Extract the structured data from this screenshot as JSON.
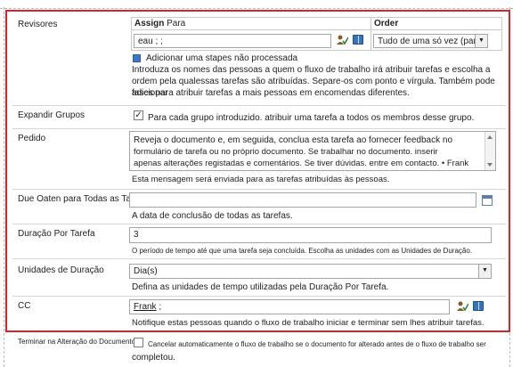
{
  "revisores": {
    "label": "Revisores",
    "assign_header": "Assign",
    "assign_header_sub": "Para",
    "order_header": "Order",
    "assign_value": "eau ; ;",
    "order_value": "Tudo de uma só vez (paralelo)",
    "add_stage": "Adicionar uma stapes não processada",
    "help_1": "Introduza os nomes das pessoas a quem o fluxo de trabalho irá atribuir tarefas e escolha a",
    "help_2": "ordem pela qualessas tarefas são atribuídas. Separe-os com ponto e vírgula. Também pode adicionar",
    "help_3": "fases para atribuir tarefas a mais pessoas em encomendas diferentes."
  },
  "expandir": {
    "label": "Expandir Grupos",
    "checkbox_text": "Para cada grupo introduzido. atribuir uma tarefa a todos os membros desse grupo.",
    "checked": true
  },
  "pedido": {
    "label": "Pedido",
    "line_1": "Reveja o documento e, em seguida, conclua esta tarefa ao fornecer feedback no",
    "line_2": "formulário de tarefa ou no próprio documento. Se trabalhar no documento. inserir",
    "line_3": "apenas alterações registadas e comentários. Se tiver dúvidas. entre em contacto. • Frank",
    "help": "Esta mensagem será enviada para as tarefas atribuídas às pessoas."
  },
  "due": {
    "label": "Due Oaten para Todas as Tarefas",
    "help": "A data de conclusão de todas as tarefas."
  },
  "duracao": {
    "label": "Duração Por Tarefa",
    "value": "3",
    "help": "O período de tempo até que uma tarefa seja concluída. Escolha as unidades com as Unidades de Duração."
  },
  "unidades": {
    "label": "Unidades de Duração",
    "value": "Dia(s)",
    "help": "Defina as unidades de tempo utilizadas pela Duração Por Tarefa."
  },
  "cc": {
    "label": "CC",
    "value": "Frank",
    "value_suffix": ";",
    "help": "Notifique estas pessoas quando o fluxo de trabalho iniciar e terminar sem lhes atribuir tarefas."
  },
  "terminar": {
    "label": "Terminar na Alteração do Documento",
    "checkbox_text": "Cancelar automaticamente o fluxo de trabalho se o documento for alterado antes de o fluxo de trabalho ser",
    "checkbox_text_2": "completou.",
    "checked": false
  },
  "colors": {
    "frame": "#d8232a",
    "accent_blue": "#3c78c6"
  }
}
